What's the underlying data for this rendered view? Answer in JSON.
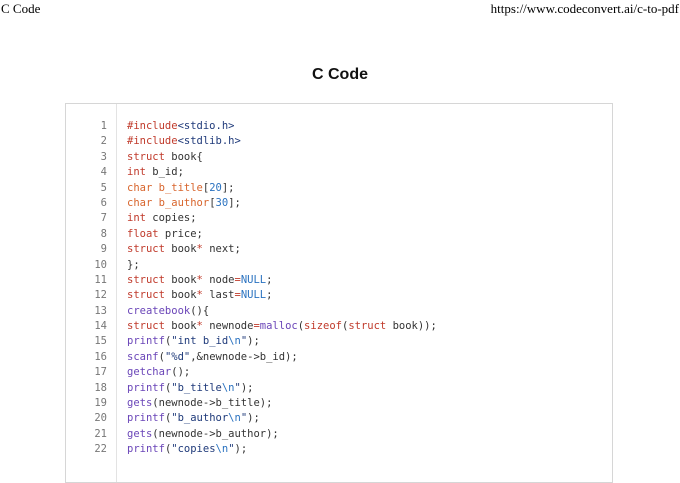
{
  "print_header": {
    "title": "C Code",
    "url": "https://www.codeconvert.ai/c-to-pdf"
  },
  "document": {
    "title": "C Code"
  },
  "colors": {
    "keyword": "#c03a2b",
    "type": "#d8652d",
    "function": "#6a45b8",
    "number": "#2a72c0",
    "string": "#1f3a7a",
    "line_number": "#777777"
  },
  "code": {
    "lines": [
      {
        "n": "1",
        "tokens": [
          {
            "t": "#include",
            "c": "kw"
          },
          {
            "t": "<stdio.h>",
            "c": "str"
          }
        ]
      },
      {
        "n": "2",
        "tokens": [
          {
            "t": "#include",
            "c": "kw"
          },
          {
            "t": "<stdlib.h>",
            "c": "str"
          }
        ]
      },
      {
        "n": "3",
        "tokens": [
          {
            "t": "struct",
            "c": "kw"
          },
          {
            "t": " book{",
            "c": ""
          }
        ]
      },
      {
        "n": "4",
        "tokens": [
          {
            "t": "int",
            "c": "kw"
          },
          {
            "t": " b_id;",
            "c": ""
          }
        ]
      },
      {
        "n": "5",
        "tokens": [
          {
            "t": "char",
            "c": "ty"
          },
          {
            "t": " b_title",
            "c": "ty"
          },
          {
            "t": "[",
            "c": ""
          },
          {
            "t": "20",
            "c": "num"
          },
          {
            "t": "];",
            "c": ""
          }
        ]
      },
      {
        "n": "6",
        "tokens": [
          {
            "t": "char",
            "c": "ty"
          },
          {
            "t": " b_author",
            "c": "ty"
          },
          {
            "t": "[",
            "c": ""
          },
          {
            "t": "30",
            "c": "num"
          },
          {
            "t": "];",
            "c": ""
          }
        ]
      },
      {
        "n": "7",
        "tokens": [
          {
            "t": "int",
            "c": "kw"
          },
          {
            "t": " copies;",
            "c": ""
          }
        ]
      },
      {
        "n": "8",
        "tokens": [
          {
            "t": "float",
            "c": "kw"
          },
          {
            "t": " price;",
            "c": ""
          }
        ]
      },
      {
        "n": "9",
        "tokens": [
          {
            "t": "struct",
            "c": "kw"
          },
          {
            "t": " book",
            "c": ""
          },
          {
            "t": "*",
            "c": "op"
          },
          {
            "t": " next;",
            "c": ""
          }
        ]
      },
      {
        "n": "10",
        "tokens": [
          {
            "t": "};",
            "c": ""
          }
        ]
      },
      {
        "n": "11",
        "tokens": [
          {
            "t": "struct",
            "c": "kw"
          },
          {
            "t": " book",
            "c": ""
          },
          {
            "t": "*",
            "c": "op"
          },
          {
            "t": " node",
            "c": ""
          },
          {
            "t": "=",
            "c": "op"
          },
          {
            "t": "NULL",
            "c": "num"
          },
          {
            "t": ";",
            "c": ""
          }
        ]
      },
      {
        "n": "12",
        "tokens": [
          {
            "t": "struct",
            "c": "kw"
          },
          {
            "t": " book",
            "c": ""
          },
          {
            "t": "*",
            "c": "op"
          },
          {
            "t": " last",
            "c": ""
          },
          {
            "t": "=",
            "c": "op"
          },
          {
            "t": "NULL",
            "c": "num"
          },
          {
            "t": ";",
            "c": ""
          }
        ]
      },
      {
        "n": "13",
        "tokens": [
          {
            "t": "createbook",
            "c": "fn"
          },
          {
            "t": "(){",
            "c": ""
          }
        ]
      },
      {
        "n": "14",
        "tokens": [
          {
            "t": "struct",
            "c": "kw"
          },
          {
            "t": " book",
            "c": ""
          },
          {
            "t": "*",
            "c": "op"
          },
          {
            "t": " newnode",
            "c": ""
          },
          {
            "t": "=",
            "c": "op"
          },
          {
            "t": "malloc",
            "c": "fn"
          },
          {
            "t": "(",
            "c": ""
          },
          {
            "t": "sizeof",
            "c": "kw"
          },
          {
            "t": "(",
            "c": ""
          },
          {
            "t": "struct",
            "c": "kw"
          },
          {
            "t": " book));",
            "c": ""
          }
        ]
      },
      {
        "n": "15",
        "tokens": [
          {
            "t": "printf",
            "c": "fn"
          },
          {
            "t": "(",
            "c": ""
          },
          {
            "t": "\"int b_id",
            "c": "str"
          },
          {
            "t": "\\n",
            "c": "esc"
          },
          {
            "t": "\"",
            "c": "str"
          },
          {
            "t": ");",
            "c": ""
          }
        ]
      },
      {
        "n": "16",
        "tokens": [
          {
            "t": "scanf",
            "c": "fn"
          },
          {
            "t": "(",
            "c": ""
          },
          {
            "t": "\"%d\"",
            "c": "str"
          },
          {
            "t": ",&newnode->b_id);",
            "c": ""
          }
        ]
      },
      {
        "n": "17",
        "tokens": [
          {
            "t": "getchar",
            "c": "fn"
          },
          {
            "t": "();",
            "c": ""
          }
        ]
      },
      {
        "n": "18",
        "tokens": [
          {
            "t": "printf",
            "c": "fn"
          },
          {
            "t": "(",
            "c": ""
          },
          {
            "t": "\"b_title",
            "c": "str"
          },
          {
            "t": "\\n",
            "c": "esc"
          },
          {
            "t": "\"",
            "c": "str"
          },
          {
            "t": ");",
            "c": ""
          }
        ]
      },
      {
        "n": "19",
        "tokens": [
          {
            "t": "gets",
            "c": "fn"
          },
          {
            "t": "(newnode->b_title);",
            "c": ""
          }
        ]
      },
      {
        "n": "20",
        "tokens": [
          {
            "t": "printf",
            "c": "fn"
          },
          {
            "t": "(",
            "c": ""
          },
          {
            "t": "\"b_author",
            "c": "str"
          },
          {
            "t": "\\n",
            "c": "esc"
          },
          {
            "t": "\"",
            "c": "str"
          },
          {
            "t": ");",
            "c": ""
          }
        ]
      },
      {
        "n": "21",
        "tokens": [
          {
            "t": "gets",
            "c": "fn"
          },
          {
            "t": "(newnode->b_author);",
            "c": ""
          }
        ]
      },
      {
        "n": "22",
        "tokens": [
          {
            "t": "printf",
            "c": "fn"
          },
          {
            "t": "(",
            "c": ""
          },
          {
            "t": "\"copies",
            "c": "str"
          },
          {
            "t": "\\n",
            "c": "esc"
          },
          {
            "t": "\"",
            "c": "str"
          },
          {
            "t": ");",
            "c": ""
          }
        ]
      }
    ]
  }
}
